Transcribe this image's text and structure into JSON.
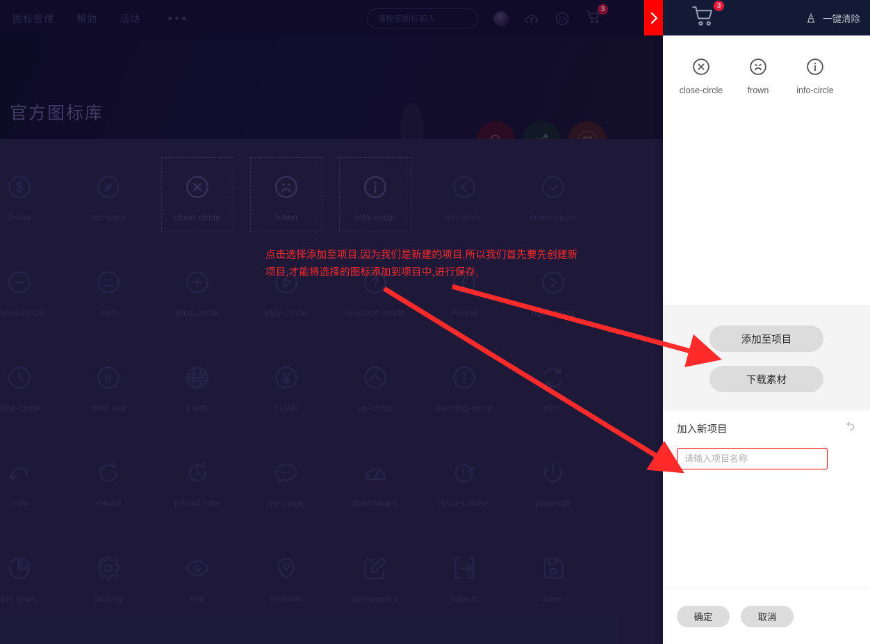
{
  "topnav": {
    "links": [
      {
        "label": "图标管理",
        "name": "nav-icon-management"
      },
      {
        "label": "帮助",
        "name": "nav-help"
      },
      {
        "label": "活动",
        "name": "nav-activity"
      }
    ],
    "more_label": "•••",
    "search_placeholder": "请搜索图标和人",
    "lang_label": "En",
    "cart_badge": "3"
  },
  "hero": {
    "title": "官方图标库",
    "fab_reward_label": "赏"
  },
  "grid": {
    "icons": [
      {
        "label": "Dollar",
        "icon": "dollar-circle-icon",
        "selected": false
      },
      {
        "label": "compass",
        "icon": "compass-icon",
        "selected": false
      },
      {
        "label": "close-circle",
        "icon": "close-circle-icon",
        "selected": true
      },
      {
        "label": "frown",
        "icon": "frown-icon",
        "selected": true
      },
      {
        "label": "info-circle",
        "icon": "info-circle-icon",
        "selected": true
      },
      {
        "label": "left-circle",
        "icon": "left-circle-icon",
        "selected": false
      },
      {
        "label": "down-circle",
        "icon": "down-circle-icon",
        "selected": false
      },
      {
        "label": "minus-circle",
        "icon": "minus-circle-icon",
        "selected": false
      },
      {
        "label": "meh",
        "icon": "meh-icon",
        "selected": false
      },
      {
        "label": "plus-circle",
        "icon": "plus-circle-icon",
        "selected": false
      },
      {
        "label": "play-circle",
        "icon": "play-circle-icon",
        "selected": false
      },
      {
        "label": "question-circle",
        "icon": "question-circle-icon",
        "selected": false
      },
      {
        "label": "Pound",
        "icon": "pound-circle-icon",
        "selected": false
      },
      {
        "label": "right-circle",
        "icon": "right-circle-icon",
        "selected": false
      },
      {
        "label": "time-circle",
        "icon": "clock-circle-icon",
        "selected": false
      },
      {
        "label": "time out",
        "icon": "pause-circle-icon",
        "selected": false
      },
      {
        "label": "earth",
        "icon": "globe-icon",
        "selected": false
      },
      {
        "label": "YUAN",
        "icon": "yuan-circle-icon",
        "selected": false
      },
      {
        "label": "up-circle",
        "icon": "up-circle-icon",
        "selected": false
      },
      {
        "label": "warning-circle",
        "icon": "warning-circle-icon",
        "selected": false
      },
      {
        "label": "sync",
        "icon": "sync-icon",
        "selected": false
      },
      {
        "label": "redo",
        "icon": "redo-icon",
        "selected": false
      },
      {
        "label": "reload",
        "icon": "reload-icon",
        "selected": false
      },
      {
        "label": "reload time",
        "icon": "reload-time-icon",
        "selected": false
      },
      {
        "label": "message",
        "icon": "message-icon",
        "selected": false
      },
      {
        "label": "dashboard",
        "icon": "dashboard-icon",
        "selected": false
      },
      {
        "label": "issues close",
        "icon": "issues-close-icon",
        "selected": false
      },
      {
        "label": "poweroff",
        "icon": "poweroff-icon",
        "selected": false
      },
      {
        "label": "pie chart",
        "icon": "pie-chart-icon",
        "selected": false
      },
      {
        "label": "setting",
        "icon": "gear-icon",
        "selected": false
      },
      {
        "label": "eye",
        "icon": "eye-icon",
        "selected": false
      },
      {
        "label": "location",
        "icon": "location-pin-icon",
        "selected": false
      },
      {
        "label": "edit-square",
        "icon": "edit-square-icon",
        "selected": false
      },
      {
        "label": "export",
        "icon": "export-icon",
        "selected": false
      },
      {
        "label": "save",
        "icon": "save-icon",
        "selected": false
      }
    ]
  },
  "annotation": {
    "text": "点击选择添加至项目,因为我们是新建的项目,所以我们首先要先创建新项目,才能将选择的图标添加到项目中,进行保存,",
    "color": "#ff2b2b"
  },
  "panel": {
    "cart_badge": "3",
    "clear_all_label": "一键清除",
    "items": [
      {
        "label": "close-circle",
        "icon": "close-circle-icon"
      },
      {
        "label": "frown",
        "icon": "frown-icon"
      },
      {
        "label": "info-circle",
        "icon": "info-circle-icon"
      }
    ],
    "add_to_project_label": "添加至项目",
    "download_label": "下载素材",
    "new_project_title": "加入新项目",
    "new_project_placeholder": "请输入项目名称",
    "new_project_value": "",
    "confirm_label": "确定",
    "cancel_label": "取消",
    "input_border_color": "#ff0000"
  }
}
